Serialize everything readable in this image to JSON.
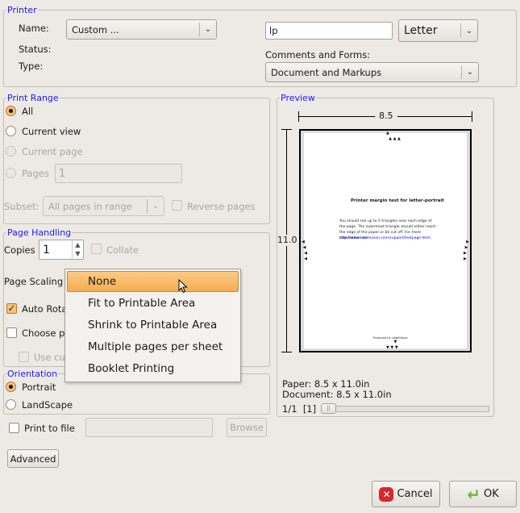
{
  "printer": {
    "title": "Printer",
    "name_label": "Name:",
    "name_value": "Custom ...",
    "status_label": "Status:",
    "type_label": "Type:",
    "command_value": "lp",
    "paper_size": "Letter",
    "comments_label": "Comments and Forms:",
    "comments_value": "Document and Markups"
  },
  "print_range": {
    "title": "Print Range",
    "all": "All",
    "current_view": "Current view",
    "current_page": "Current page",
    "pages": "Pages",
    "pages_value": "1",
    "subset_label": "Subset:",
    "subset_value": "All pages in range",
    "reverse_pages": "Reverse pages"
  },
  "page_handling": {
    "title": "Page Handling",
    "copies_label": "Copies",
    "copies_value": "1",
    "collate": "Collate",
    "page_scaling_label": "Page Scaling",
    "auto_rotate": "Auto Rota",
    "choose_paper": "Choose pa",
    "use_custom": "Use cu"
  },
  "scaling_menu": {
    "items": [
      "None",
      "Fit to Printable Area",
      "Shrink to Printable Area",
      "Multiple pages per sheet",
      "Booklet Printing"
    ],
    "selected": "None"
  },
  "orientation": {
    "title": "Orientation",
    "portrait": "Portrait",
    "landscape": "LandScape"
  },
  "print_to_file": {
    "label": "Print to file",
    "path_value": "",
    "browse": "Browse"
  },
  "advanced_button": "Advanced",
  "preview": {
    "title": "Preview",
    "width_label": "8.5",
    "height_label": "11.0",
    "page_heading": "Printer margin test for letter-portrait",
    "page_body": "You should see up to 5 triangles near each edge of the page. The outermost triangle should either reach the edge of the paper or be cut off. For more information see",
    "page_link": "http://www.labelvision.com/support/testpage.html",
    "page_footer": "Produced by LabelVision",
    "paper": "Paper: 8.5 x 11.0in",
    "document": "Document: 8.5 x 11.0in",
    "page_counter": "1/1  [1]"
  },
  "buttons": {
    "cancel": "Cancel",
    "ok": "OK"
  }
}
